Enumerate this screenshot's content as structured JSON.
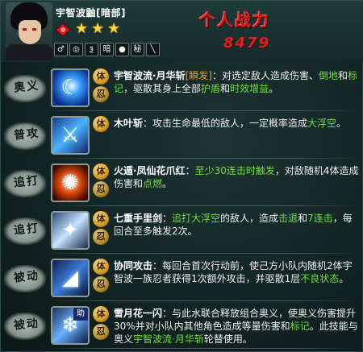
{
  "header": {
    "char_name": "宇智波鼬[暗部]",
    "rating_stars": 3,
    "element_icons": [
      "♂",
      "◎",
      "ѯ",
      "暗",
      "●",
      "秘",
      "╲"
    ],
    "power_title": "个人战力",
    "power_value": "8479"
  },
  "medals": {
    "ti": "体",
    "ren": "忍"
  },
  "skills": [
    {
      "type": "奥义",
      "icon_name": "moon-blade-icon",
      "glyph": "☾",
      "parts": [
        {
          "t": "宇智波流·月华斩",
          "c": "name"
        },
        {
          "t": "[瞬发]",
          "c": "tag-orange"
        },
        {
          "t": "：对选定敌人造成伤害、",
          "c": ""
        },
        {
          "t": "倒地",
          "c": "kw-green"
        },
        {
          "t": "和",
          "c": ""
        },
        {
          "t": "标记",
          "c": "kw-green"
        },
        {
          "t": "，驱散其身上全部",
          "c": ""
        },
        {
          "t": "护盾",
          "c": "kw-green"
        },
        {
          "t": "和",
          "c": ""
        },
        {
          "t": "时效增益",
          "c": "kw-green"
        },
        {
          "t": "。",
          "c": ""
        }
      ],
      "medals": [
        "ti",
        "ren"
      ]
    },
    {
      "type": "普攻",
      "icon_name": "kunai-slash-icon",
      "glyph": "⚔",
      "parts": [
        {
          "t": "木叶斩",
          "c": "name"
        },
        {
          "t": "：攻击生命最低的敌人，一定概率造成",
          "c": ""
        },
        {
          "t": "大浮空",
          "c": "kw-green"
        },
        {
          "t": "。",
          "c": ""
        }
      ],
      "medals": [
        "ti"
      ]
    },
    {
      "type": "追打",
      "icon_name": "fire-claw-icon",
      "glyph": "✺",
      "parts": [
        {
          "t": "火遁·凤仙花爪红",
          "c": "name"
        },
        {
          "t": "：",
          "c": ""
        },
        {
          "t": "至少30连击时触发",
          "c": "kw-green"
        },
        {
          "t": "，对敌随机4体造成伤害和",
          "c": ""
        },
        {
          "t": "点燃",
          "c": "kw-green"
        },
        {
          "t": "。",
          "c": ""
        }
      ],
      "medals": [
        "ti",
        "ren"
      ]
    },
    {
      "type": "追打",
      "icon_name": "shuriken-icon",
      "glyph": "✦",
      "parts": [
        {
          "t": "七重手里剑",
          "c": "name"
        },
        {
          "t": "：",
          "c": ""
        },
        {
          "t": "追打大浮空",
          "c": "kw-green"
        },
        {
          "t": "的敌人，造成",
          "c": ""
        },
        {
          "t": "击退",
          "c": "kw-green"
        },
        {
          "t": "和",
          "c": ""
        },
        {
          "t": "7连击",
          "c": "kw-green"
        },
        {
          "t": "，每回合至多触发2次。",
          "c": ""
        }
      ],
      "medals": [
        "ti",
        "ren"
      ]
    },
    {
      "type": "被动",
      "icon_name": "cooperation-icon",
      "glyph": "◢",
      "parts": [
        {
          "t": "协同攻击",
          "c": "name"
        },
        {
          "t": "：每回合首次行动前，使己方小队内随机2体宇智波一族忍者获得1次额外攻击，并驱散1层",
          "c": ""
        },
        {
          "t": "不良状态",
          "c": "kw-green"
        },
        {
          "t": "。",
          "c": ""
        }
      ],
      "medals": [
        "ti",
        "ren"
      ]
    },
    {
      "type": "被动",
      "icon_name": "snow-flower-flash-icon",
      "glyph": "❄",
      "corner": "助",
      "parts": [
        {
          "t": "雪月花一闪",
          "c": "name"
        },
        {
          "t": "：与此水联合释放组合奥义，使奥义伤害提升30%并对小队内其他角色造成等量伤害和",
          "c": ""
        },
        {
          "t": "标记",
          "c": "kw-green"
        },
        {
          "t": "。此技能与奥义",
          "c": ""
        },
        {
          "t": "宇智波流·月华斩",
          "c": "kw-green"
        },
        {
          "t": "轮替使用。",
          "c": ""
        }
      ],
      "medals": [
        "ti",
        "ren"
      ]
    }
  ]
}
